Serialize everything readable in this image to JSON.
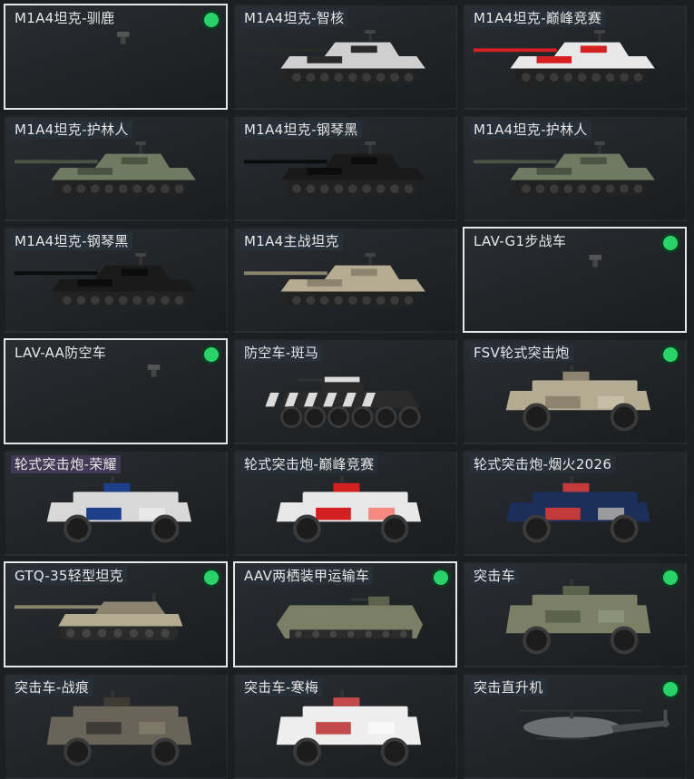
{
  "colors": {
    "owned_badge": "#2ad36a",
    "selected_border": "#e6e6e6",
    "card_bg": "#23272b"
  },
  "cards": [
    {
      "name": "M1A4坦克-驯鹿",
      "owned": true,
      "selected": true,
      "vehicle": "tank-icon",
      "skin": "none"
    },
    {
      "name": "M1A4坦克-智核",
      "owned": false,
      "selected": false,
      "vehicle": "tank",
      "skin": "bw-camo"
    },
    {
      "name": "M1A4坦克-巅峰竞赛",
      "owned": false,
      "selected": false,
      "vehicle": "tank",
      "skin": "red-white"
    },
    {
      "name": "M1A4坦克-护林人",
      "owned": false,
      "selected": false,
      "vehicle": "tank",
      "skin": "forest-camo"
    },
    {
      "name": "M1A4坦克-钢琴黑",
      "owned": false,
      "selected": false,
      "vehicle": "tank",
      "skin": "black"
    },
    {
      "name": "M1A4坦克-护林人",
      "owned": false,
      "selected": false,
      "vehicle": "tank",
      "skin": "forest-camo"
    },
    {
      "name": "M1A4坦克-钢琴黑",
      "owned": false,
      "selected": false,
      "vehicle": "tank",
      "skin": "black"
    },
    {
      "name": "M1A4主战坦克",
      "owned": false,
      "selected": false,
      "vehicle": "tank",
      "skin": "desert"
    },
    {
      "name": "LAV-G1步战车",
      "owned": true,
      "selected": true,
      "vehicle": "ifv-icon",
      "skin": "none"
    },
    {
      "name": "LAV-AA防空车",
      "owned": true,
      "selected": true,
      "vehicle": "aa-icon",
      "skin": "none"
    },
    {
      "name": "防空车-斑马",
      "owned": false,
      "selected": false,
      "vehicle": "apc",
      "skin": "zebra"
    },
    {
      "name": "FSV轮式突击炮",
      "owned": true,
      "selected": false,
      "vehicle": "wheeled",
      "skin": "desert"
    },
    {
      "name": "轮式突击炮-荣耀",
      "owned": false,
      "selected": false,
      "vehicle": "wheeled",
      "skin": "blue-white"
    },
    {
      "name": "轮式突击炮-巅峰竞赛",
      "owned": false,
      "selected": false,
      "vehicle": "wheeled",
      "skin": "red-white"
    },
    {
      "name": "轮式突击炮-烟火2026",
      "owned": false,
      "selected": false,
      "vehicle": "wheeled",
      "skin": "navy-fireworks"
    },
    {
      "name": "GTQ-35轻型坦克",
      "owned": true,
      "selected": true,
      "vehicle": "light-tank",
      "skin": "desert"
    },
    {
      "name": "AAV两栖装甲运输车",
      "owned": true,
      "selected": true,
      "vehicle": "amphibious",
      "skin": "olive"
    },
    {
      "name": "突击车",
      "owned": true,
      "selected": false,
      "vehicle": "mrap",
      "skin": "olive"
    },
    {
      "name": "突击车-战痕",
      "owned": false,
      "selected": false,
      "vehicle": "mrap",
      "skin": "worn"
    },
    {
      "name": "突击车-寒梅",
      "owned": false,
      "selected": false,
      "vehicle": "mrap",
      "skin": "white-plum"
    },
    {
      "name": "突击直升机",
      "owned": true,
      "selected": false,
      "vehicle": "helicopter",
      "skin": "grey"
    }
  ]
}
